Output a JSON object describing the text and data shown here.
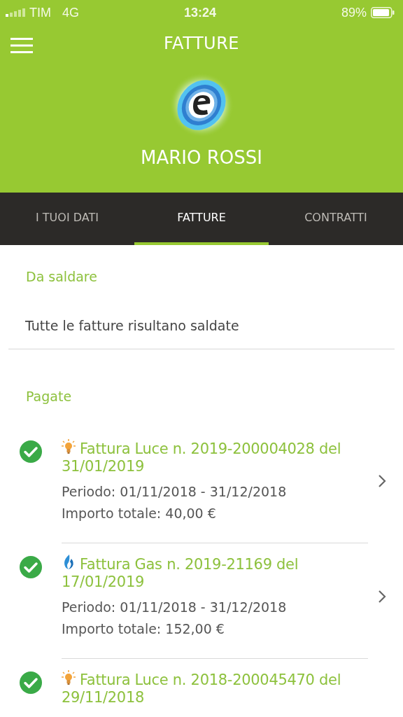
{
  "status_bar": {
    "carrier": "TIM",
    "network": "4G",
    "time": "13:24",
    "battery": "89%"
  },
  "header": {
    "title": "FATTURE",
    "user_name": "MARIO ROSSI"
  },
  "tabs": [
    {
      "label": "I TUOI DATI",
      "selected": false
    },
    {
      "label": "FATTURE",
      "selected": true
    },
    {
      "label": "CONTRATTI",
      "selected": false
    }
  ],
  "unpaid": {
    "heading": "Da saldare",
    "message": "Tutte le fatture risultano saldate"
  },
  "paid": {
    "heading": "Pagate",
    "invoices": [
      {
        "kind": "luce",
        "title": "Fattura Luce n. 2019-200004028 del 31/01/2019",
        "period": "Periodo: 01/11/2018 - 31/12/2018",
        "amount": "Importo totale: 40,00 €"
      },
      {
        "kind": "gas",
        "title": "Fattura Gas n. 2019-21169 del 17/01/2019",
        "period": "Periodo: 01/11/2018 - 31/12/2018",
        "amount": "Importo totale: 152,00 €"
      },
      {
        "kind": "luce",
        "title": "Fattura Luce n. 2018-200045470 del 29/11/2018"
      }
    ]
  }
}
